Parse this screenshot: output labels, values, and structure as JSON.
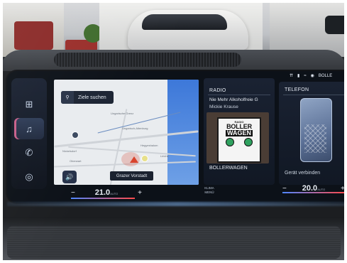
{
  "sidebar": {
    "items": [
      {
        "icon": "grid-icon",
        "glyph": "⊞"
      },
      {
        "icon": "music-note-icon",
        "glyph": "♫"
      },
      {
        "icon": "phone-icon",
        "glyph": "✆"
      },
      {
        "icon": "car-settings-icon",
        "glyph": "◎"
      }
    ]
  },
  "map": {
    "search_label": "Ziele suchen",
    "location_label": "Grazer Vorstadt",
    "labels": [
      "Ungarisch-Altenburg",
      "Hegyeshalom",
      "Nickelsdorf",
      "Oberwart",
      "Lirichs",
      "Ungarische Grenz"
    ]
  },
  "climate_left": {
    "minus": "−",
    "temp": "21.0",
    "unit": "AUTO",
    "plus": "+"
  },
  "klima_label": "KLIMA MENÜ",
  "radio": {
    "title": "RADIO",
    "song": "Nie Mehr Alkoholfreie G",
    "artist": "Mickie Krause",
    "cover_top": "RADIO",
    "cover_line1": "BOLLER",
    "cover_line2": "WAGEN",
    "station": "BOLLERWAGEN"
  },
  "status": {
    "text": "BOLLE"
  },
  "phone": {
    "title": "TELEFON",
    "connect": "Gerät verbinden"
  },
  "climate_right": {
    "minus": "−",
    "temp": "20.0",
    "unit": "AUTO",
    "plus": "+"
  },
  "colors": {
    "accent_active": "#c75f8a",
    "temp_cold": "#4f86ff",
    "temp_hot": "#ff4a4a",
    "map_blue": "#3d78d9"
  }
}
